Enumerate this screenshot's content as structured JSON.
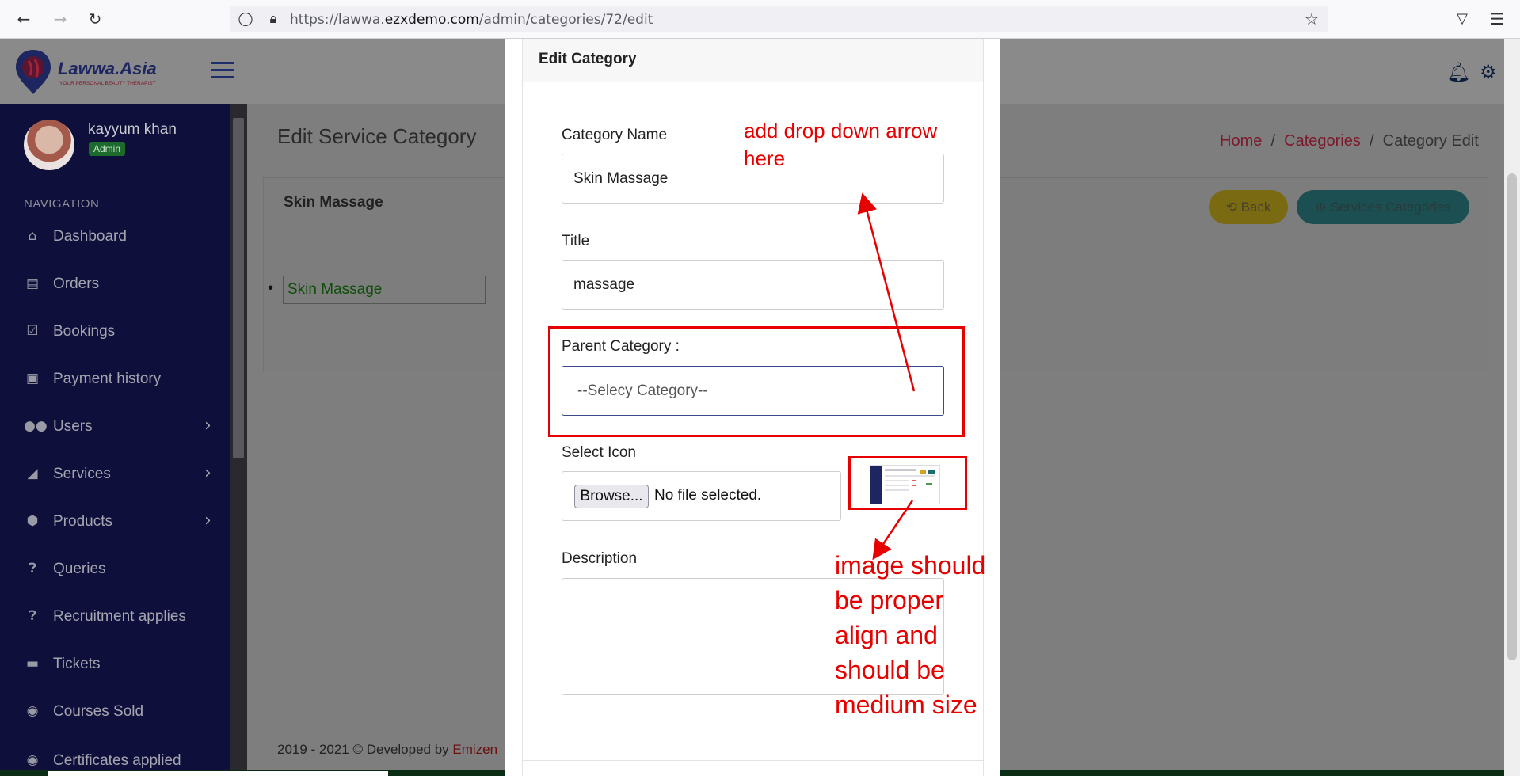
{
  "browser": {
    "url_prefix": "https://lawwa.",
    "url_domain": "ezxdemo.com",
    "url_path": "/admin/categories/72/edit"
  },
  "app": {
    "logo_text": "Lawwa.Asia",
    "logo_tagline": "YOUR PERSONAL BEAUTY THERAPIST",
    "user_name": "kayyum khan",
    "user_role": "Admin"
  },
  "sidebar": {
    "heading": "NAVIGATION",
    "items": [
      {
        "label": "Dashboard",
        "icon": "home-icon"
      },
      {
        "label": "Orders",
        "icon": "orders-icon"
      },
      {
        "label": "Bookings",
        "icon": "calendar-icon"
      },
      {
        "label": "Payment history",
        "icon": "money-icon"
      },
      {
        "label": "Users",
        "icon": "users-icon"
      },
      {
        "label": "Services",
        "icon": "services-icon"
      },
      {
        "label": "Products",
        "icon": "box-icon"
      },
      {
        "label": "Queries",
        "icon": "question-icon"
      },
      {
        "label": "Recruitment applies",
        "icon": "question-icon"
      },
      {
        "label": "Tickets",
        "icon": "ticket-icon"
      },
      {
        "label": "Courses Sold",
        "icon": "chat-icon"
      },
      {
        "label": "Certificates applied",
        "icon": "certificate-icon"
      }
    ]
  },
  "page": {
    "title": "Edit Service Category",
    "breadcrumb": [
      "Home",
      "Categories",
      "Category Edit"
    ],
    "card_title": "Skin Massage",
    "back_button": "Back",
    "services_button": "Services Categories",
    "tree_value": "Skin Massage",
    "footer_text": "2019 - 2021 © Developed by ",
    "footer_link": "Emizen"
  },
  "modal": {
    "title": "Edit Category",
    "category_name_label": "Category Name",
    "category_name_value": "Skin Massage",
    "title_label": "Title",
    "title_value": "massage",
    "parent_label": "Parent Category :",
    "parent_value": "--Selecy Category--",
    "icon_label": "Select Icon",
    "browse_label": "Browse...",
    "file_status": "No file selected.",
    "description_label": "Description"
  },
  "annotations": {
    "dropdown_note_line1": "add drop down arrow",
    "dropdown_note_line2": "here",
    "image_note": [
      "image should",
      "be proper",
      "align and",
      "should be",
      "medium size"
    ],
    "color": "#e60000"
  }
}
